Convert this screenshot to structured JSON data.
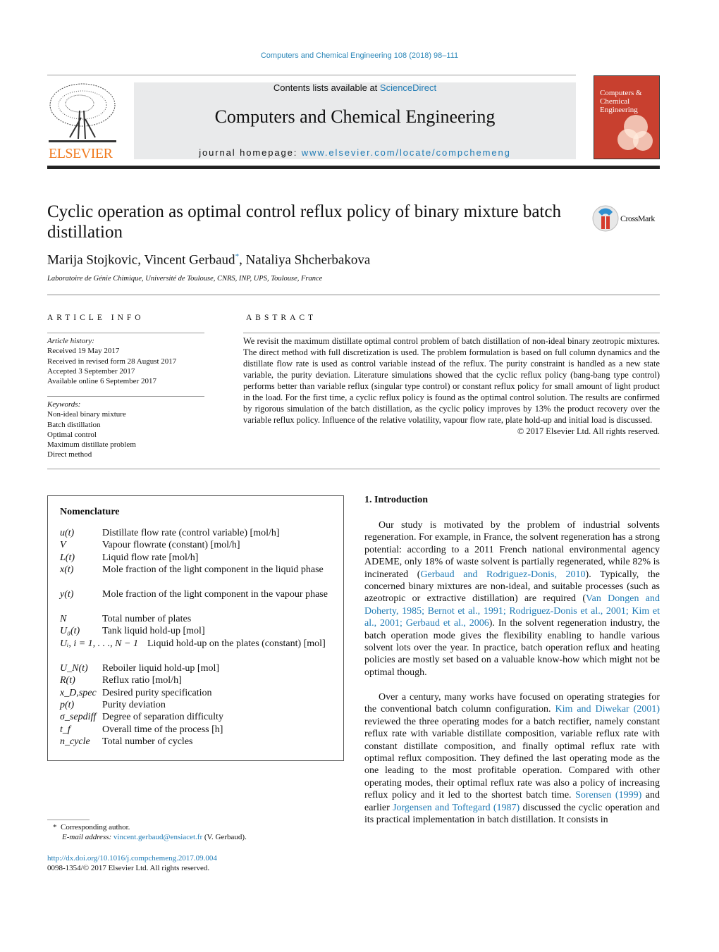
{
  "journal_ref": "Computers and Chemical Engineering 108 (2018) 98–111",
  "header": {
    "contents_prefix": "Contents lists available at ",
    "sciencedirect": "ScienceDirect",
    "journal_title": "Computers and Chemical Engineering",
    "homepage_prefix": "journal homepage: ",
    "homepage_url": "www.elsevier.com/locate/compchemeng",
    "publisher": "ELSEVIER",
    "cover_title": "Computers & Chemical Engineering"
  },
  "article": {
    "title": "Cyclic operation as optimal control reflux policy of binary mixture batch distillation",
    "crossmark": "CrossMark",
    "authors": [
      "Marija Stojkovic, Vincent Gerbaud",
      "*",
      ", Nataliya Shcherbakova"
    ],
    "affiliation": "Laboratoire de Génie Chimique, Université de Toulouse, CNRS, INP, UPS, Toulouse, France"
  },
  "article_info": {
    "heading": "ARTICLE INFO",
    "history_label": "Article history:",
    "history": [
      "Received 19 May 2017",
      "Received in revised form 28 August 2017",
      "Accepted 3 September 2017",
      "Available online 6 September 2017"
    ],
    "keywords_label": "Keywords:",
    "keywords": [
      "Non-ideal binary mixture",
      "Batch distillation",
      "Optimal control",
      "Maximum distillate problem",
      "Direct method"
    ]
  },
  "abstract": {
    "heading": "ABSTRACT",
    "text": "We revisit the maximum distillate optimal control problem of batch distillation of non-ideal binary zeotropic mixtures. The direct method with full discretization is used. The problem formulation is based on full column dynamics and the distillate flow rate is used as control variable instead of the reflux. The purity constraint is handled as a new state variable, the purity deviation. Literature simulations showed that the cyclic reflux policy (bang-bang type control) performs better than variable reflux (singular type control) or constant reflux policy for small amount of light product in the load. For the first time, a cyclic reflux policy is found as the optimal control solution. The results are confirmed by rigorous simulation of the batch distillation, as the cyclic policy improves by 13% the product recovery over the variable reflux policy. Influence of the relative volatility, vapour flow rate, plate hold-up and initial load is discussed.",
    "copyright": "© 2017 Elsevier Ltd. All rights reserved."
  },
  "nomenclature": {
    "heading": "Nomenclature",
    "items": [
      {
        "sym": "u(t)",
        "def": "Distillate flow rate (control variable) [mol/h]"
      },
      {
        "sym": "V",
        "def": "Vapour flowrate (constant) [mol/h]"
      },
      {
        "sym": "L(t)",
        "def": "Liquid flow rate [mol/h]"
      },
      {
        "sym": "x(t)",
        "def": "Mole fraction of the light component in the liquid phase"
      },
      {
        "sym": "y(t)",
        "def": "Mole fraction of the light component in the vapour phase"
      },
      {
        "sym": "N",
        "def": "Total number of plates"
      },
      {
        "sym": "U₀(t)",
        "def": "Tank liquid hold-up [mol]"
      },
      {
        "sym": "Uᵢ, i = 1, . . ., N − 1",
        "def": "Liquid hold-up on the plates (constant) [mol]"
      },
      {
        "sym": "U_N(t)",
        "def": "Reboiler liquid hold-up [mol]"
      },
      {
        "sym": "R(t)",
        "def": "Reflux ratio [mol/h]"
      },
      {
        "sym": "x_D,spec",
        "def": "Desired purity specification"
      },
      {
        "sym": "p(t)",
        "def": "Purity deviation"
      },
      {
        "sym": "σ_sepdiff",
        "def": "Degree of separation difficulty"
      },
      {
        "sym": "t_f",
        "def": "Overall time of the process [h]"
      },
      {
        "sym": "n_cycle",
        "def": "Total number of cycles"
      }
    ]
  },
  "intro": {
    "heading": "1.  Introduction",
    "p1": [
      "Our study is motivated by the problem of industrial solvents regeneration. For example, in France, the solvent regeneration has a strong potential: according to a 2011 French national environmental agency ADEME, only 18% of waste solvent is partially regenerated, while 82% is incinerated (",
      "Gerbaud and Rodriguez-Donis, 2010",
      "). Typically, the concerned binary mixtures are non-ideal, and suitable processes (such as azeotropic or extractive distillation) are required (",
      "Van Dongen and Doherty, 1985; Bernot et al., 1991; Rodriguez-Donis et al., 2001; Kim et al., 2001; Gerbaud et al., 2006",
      "). In the solvent regeneration industry, the batch operation mode gives the flexibility enabling to handle various solvent lots over the year. In practice, batch operation reflux and heating policies are mostly set based on a valuable know-how which might not be optimal though."
    ],
    "p2": [
      "Over a century, many works have focused on operating strategies for the conventional batch column configuration. ",
      "Kim and Diwekar (2001)",
      " reviewed the three operating modes for a batch rectifier, namely constant reflux rate with variable distillate composition, variable reflux rate with constant distillate composition, and finally optimal reflux rate with optimal reflux composition. They defined the last operating mode as the one leading to the most profitable operation. Compared with other operating modes, their optimal reflux rate was also a policy of increasing reflux policy and it led to the shortest batch time. ",
      "Sorensen (1999)",
      " and earlier ",
      "Jorgensen and Toftegard (1987)",
      " discussed the cyclic operation and its practical implementation in batch distillation. It consists in"
    ]
  },
  "footnote": {
    "star": "*",
    "corresponding": "Corresponding author.",
    "email_label": "E-mail address: ",
    "email": "vincent.gerbaud@ensiacet.fr",
    "email_suffix": " (V. Gerbaud)."
  },
  "doi": "http://dx.doi.org/10.1016/j.compchemeng.2017.09.004",
  "issn": "0098-1354/© 2017 Elsevier Ltd. All rights reserved.",
  "colors": {
    "link": "#1f7bb5",
    "elsevier_orange": "#f07a1e",
    "cover_red": "#c8402f",
    "banner_gray": "#e9eaeb"
  }
}
